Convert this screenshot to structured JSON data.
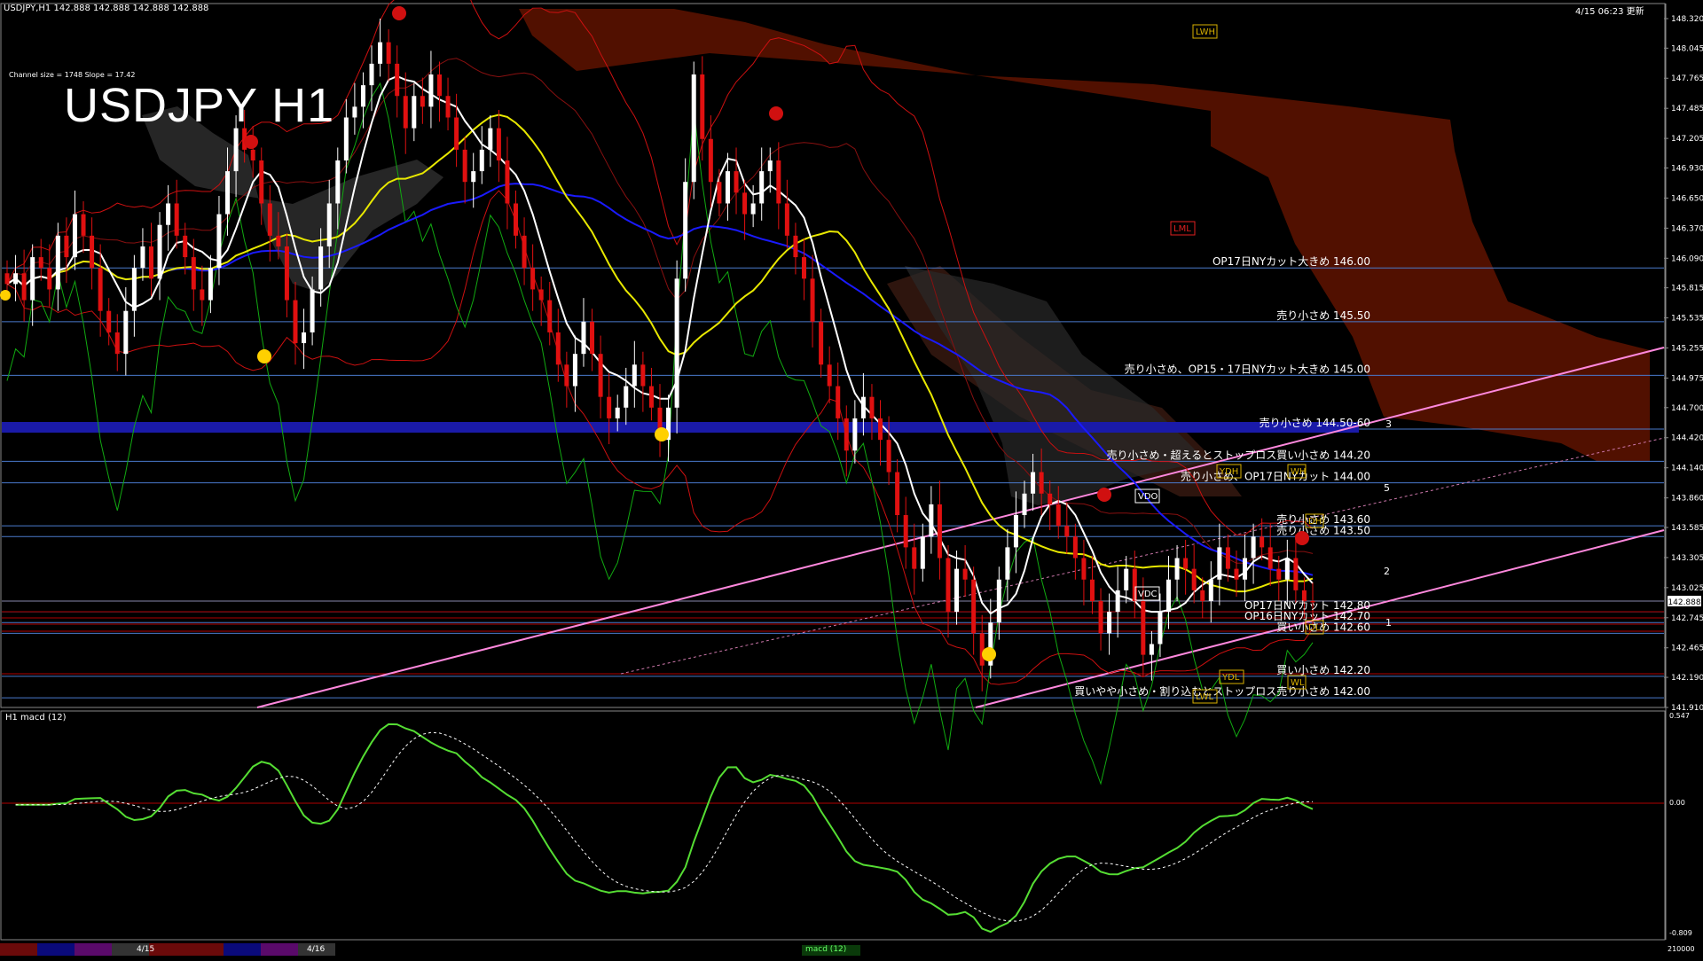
{
  "header": {
    "symbol_info": "USDJPY,H1  142.888 142.888 142.888 142.888",
    "timestamp": "4/15 06:23 更新",
    "channel_info": "Channel size = 1748 Slope = 17.42",
    "big_title": "USDJPY H1"
  },
  "macd": {
    "label": "H1  macd (12)",
    "scale": [
      "0.547",
      "0.00",
      "-0.809"
    ],
    "footer_label": "macd (12)"
  },
  "bottom": {
    "dates": [
      "4/15",
      "4/16"
    ],
    "right_value": "210000"
  },
  "chart_data": {
    "type": "candlestick",
    "symbol": "USDJPY",
    "timeframe": "H1",
    "last_price": 142.888,
    "price_label": "142.888",
    "y_ticks": [
      "148.320",
      "148.045",
      "147.765",
      "147.485",
      "147.205",
      "146.930",
      "146.650",
      "146.370",
      "146.090",
      "145.815",
      "145.535",
      "145.255",
      "144.975",
      "144.700",
      "144.420",
      "144.140",
      "143.860",
      "143.585",
      "143.305",
      "143.025",
      "142.745",
      "142.465",
      "142.190",
      "141.910"
    ],
    "ylim": [
      141.91,
      148.46
    ],
    "levels": [
      {
        "price": 146.0,
        "text": "OP17日NYカット大きめ 146.00"
      },
      {
        "price": 145.5,
        "text": "売り小さめ 145.50"
      },
      {
        "price": 145.0,
        "text": "売り小さめ、OP15・17日NYカット大きめ 145.00"
      },
      {
        "price": 144.5,
        "text": "売り小さめ 144.50-60"
      },
      {
        "price": 144.2,
        "text": "売り小さめ・超えるとストップロス買い小さめ 144.20"
      },
      {
        "price": 144.0,
        "text": "売り小さめ、OP17日NYカット 144.00"
      },
      {
        "price": 143.6,
        "text": "売り小さめ 143.60"
      },
      {
        "price": 143.5,
        "text": "売り小さめ 143.50"
      },
      {
        "price": 142.8,
        "text": "OP17日NYカット 142.80"
      },
      {
        "price": 142.7,
        "text": "OP16日NYカット 142.70"
      },
      {
        "price": 142.6,
        "text": "買い小さめ 142.60"
      },
      {
        "price": 142.2,
        "text": "買い小さめ 142.20"
      },
      {
        "price": 142.0,
        "text": "買いやや小さめ・割り込むとストップロス売り小さめ 142.00"
      }
    ],
    "box_tags": [
      "LWH",
      "LML",
      "YDH",
      "WH",
      "VDO",
      "DH",
      "VDC",
      "DL",
      "WL",
      "YDL",
      "LWL"
    ],
    "wave_labels": [
      "3",
      "5",
      "2",
      "1"
    ],
    "close": [
      145.85,
      145.95,
      145.7,
      146.1,
      146.0,
      145.8,
      146.3,
      146.1,
      146.5,
      146.3,
      146.0,
      145.6,
      145.4,
      145.2,
      145.6,
      146.0,
      146.2,
      145.9,
      146.4,
      146.6,
      146.3,
      146.1,
      145.8,
      145.7,
      146.0,
      146.5,
      146.9,
      147.3,
      147.1,
      147.0,
      146.6,
      146.3,
      146.2,
      145.7,
      145.3,
      145.4,
      145.8,
      146.2,
      146.6,
      147.0,
      147.4,
      147.5,
      147.7,
      147.9,
      148.1,
      147.9,
      147.6,
      147.3,
      147.6,
      147.5,
      147.8,
      147.6,
      147.4,
      147.1,
      146.8,
      146.9,
      147.1,
      147.3,
      147.0,
      146.6,
      146.3,
      146.0,
      145.8,
      145.7,
      145.4,
      145.1,
      144.9,
      145.2,
      145.5,
      145.2,
      144.8,
      144.6,
      144.7,
      144.9,
      145.1,
      144.9,
      144.7,
      144.4,
      144.7,
      145.9,
      146.8,
      147.8,
      147.2,
      146.8,
      146.6,
      146.9,
      146.7,
      146.5,
      146.6,
      146.9,
      147.0,
      146.6,
      146.3,
      146.1,
      145.9,
      145.5,
      145.1,
      144.9,
      144.6,
      144.3,
      144.6,
      144.8,
      144.6,
      144.4,
      144.1,
      143.7,
      143.4,
      143.2,
      143.5,
      143.8,
      143.3,
      142.8,
      143.2,
      143.1,
      142.6,
      142.3,
      142.7,
      143.1,
      143.4,
      143.7,
      143.9,
      144.1,
      143.9,
      143.8,
      143.6,
      143.5,
      143.3,
      143.1,
      142.9,
      142.6,
      142.8,
      143.0,
      143.2,
      142.9,
      142.4,
      142.5,
      142.8,
      143.1,
      143.3,
      143.2,
      143.0,
      142.9,
      143.1,
      143.4,
      143.2,
      143.1,
      143.3,
      143.5,
      143.4,
      143.2,
      143.1,
      143.3,
      143.0,
      142.9,
      142.888
    ],
    "indicators": [
      "ichimoku cloud",
      "bollinger bands",
      "moving averages",
      "trend channel"
    ],
    "macd_series": {
      "name": "macd (12)",
      "ylim": [
        -0.809,
        0.547
      ]
    }
  }
}
